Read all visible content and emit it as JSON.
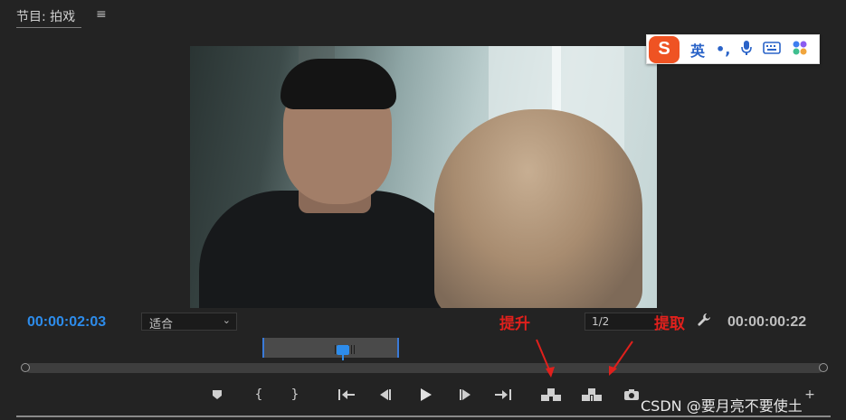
{
  "panel": {
    "title": "节目: 拍戏",
    "menu_icon": "hamburger-icon"
  },
  "ime": {
    "logo": "S",
    "lang": "英",
    "punct": "•,",
    "icons": [
      "microphone-icon",
      "keyboard-icon",
      "apps-icon"
    ]
  },
  "timecode": {
    "current": "00:00:02:03",
    "duration": "00:00:00:22"
  },
  "fit": {
    "value": "适合"
  },
  "resolution": {
    "value": "1/2"
  },
  "annotations": {
    "lift": "提升",
    "extract": "提取"
  },
  "controls": [
    {
      "name": "add-marker-button",
      "glyph": "⯆"
    },
    {
      "name": "mark-in-button",
      "glyph": "{"
    },
    {
      "name": "mark-out-button",
      "glyph": "}"
    },
    {
      "name": "go-to-in-button",
      "glyph": "{←"
    },
    {
      "name": "step-back-button",
      "glyph": "◀|"
    },
    {
      "name": "play-button",
      "glyph": "▶"
    },
    {
      "name": "step-forward-button",
      "glyph": "|▶"
    },
    {
      "name": "go-to-out-button",
      "glyph": "→}"
    },
    {
      "name": "lift-button",
      "glyph": "⊓"
    },
    {
      "name": "extract-button",
      "glyph": "⊔"
    },
    {
      "name": "export-frame-button",
      "glyph": "◉"
    }
  ],
  "watermark": "CSDN @要月亮不要使土",
  "colors": {
    "accent": "#2d8ceb",
    "annotation": "#e0201c",
    "background": "#232323"
  }
}
